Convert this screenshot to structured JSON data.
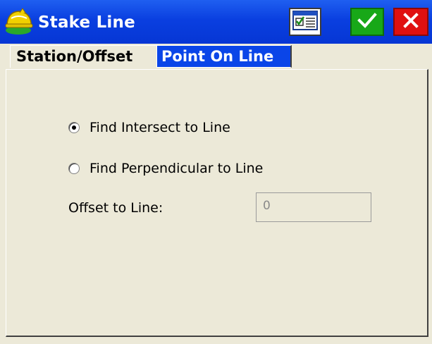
{
  "window": {
    "title": "Stake Line"
  },
  "titlebar_buttons": [
    {
      "name": "calculator-button",
      "icon": "calculator-form-icon"
    },
    {
      "name": "ok-button",
      "icon": "checkmark-icon",
      "color": "#18a818"
    },
    {
      "name": "cancel-button",
      "icon": "close-x-icon",
      "color": "#e01010"
    }
  ],
  "tabs": [
    {
      "label": "Station/Offset",
      "active": false
    },
    {
      "label": "Point On Line",
      "active": true
    }
  ],
  "options": {
    "intersect": {
      "label": "Find Intersect to Line",
      "selected": true
    },
    "perpendicular": {
      "label": "Find Perpendicular to Line",
      "selected": false
    }
  },
  "offset": {
    "label": "Offset to Line:",
    "value": "0",
    "disabled": true
  },
  "colors": {
    "titlebar": "#0a3fe0",
    "active_tab": "#0a45e8",
    "dialog_bg": "#ece9d8"
  }
}
